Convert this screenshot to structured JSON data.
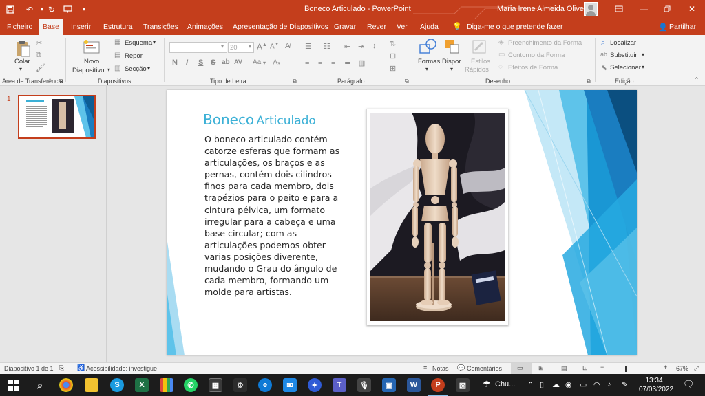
{
  "window": {
    "title": "Boneco Articulado  -  PowerPoint",
    "user_name": "Maria Irene Almeida Oliveira",
    "colors": {
      "accent": "#c43e1c",
      "ribbon_bg": "#f3f3f3",
      "slide_title": "#3bb0d6"
    }
  },
  "tabs": [
    "Ficheiro",
    "Base",
    "Inserir",
    "Estrutura",
    "Transições",
    "Animações",
    "Apresentação de Diapositivos",
    "Gravar",
    "Rever",
    "Ver",
    "Ajuda"
  ],
  "active_tab": "Base",
  "tell_me": "Diga-me o que pretende fazer",
  "share": "Partilhar",
  "ribbon": {
    "clipboard": {
      "paste": "Colar",
      "label": "Área de Transferência"
    },
    "slides": {
      "new_slide_1": "Novo",
      "new_slide_2": "Diapositivo",
      "layout": "Esquema",
      "reset": "Repor",
      "section": "Secção",
      "label": "Diapositivos"
    },
    "font": {
      "size": "20",
      "label": "Tipo de Letra",
      "bold": "N",
      "italic": "I",
      "underline": "S",
      "strike": "S",
      "spacing": "AV",
      "case": "Aa"
    },
    "paragraph": {
      "label": "Parágrafo"
    },
    "drawing": {
      "shapes": "Formas",
      "arrange": "Dispor",
      "styles_1": "Estilos",
      "styles_2": "Rápidos",
      "fill": "Preenchimento da Forma",
      "outline": "Contorno da Forma",
      "effects": "Efeitos de Forma",
      "label": "Desenho"
    },
    "editing": {
      "find": "Localizar",
      "replace": "Substituir",
      "select": "Selecionar",
      "label": "Edição"
    }
  },
  "thumbnail": {
    "number": "1"
  },
  "slide": {
    "title_word1": "Boneco",
    "title_word2": "Articulado",
    "body_lines": [
      "O boneco articulado contém",
      "catorze esferas que formam as",
      "articulações, os braços e as",
      "pernas, contém dois cilindros",
      "finos para cada membro, dois",
      "trapézios para o peito e para a",
      "cintura pélvica, um formato",
      "irregular para a cabeça e uma",
      "base circular; com as",
      "articulações podemos obter",
      "varias posições diverente,",
      "mudando o Grau do ângulo de",
      "cada membro, formando um",
      "molde para artistas."
    ]
  },
  "status": {
    "slide_count": "Diapositivo 1 de 1",
    "accessibility": "Acessibilidade: investigue",
    "notes": "Notas",
    "comments": "Comentários",
    "zoom": "67%"
  },
  "taskbar": {
    "weather": "Chu...",
    "time": "13:34",
    "date": "07/03/2022"
  }
}
